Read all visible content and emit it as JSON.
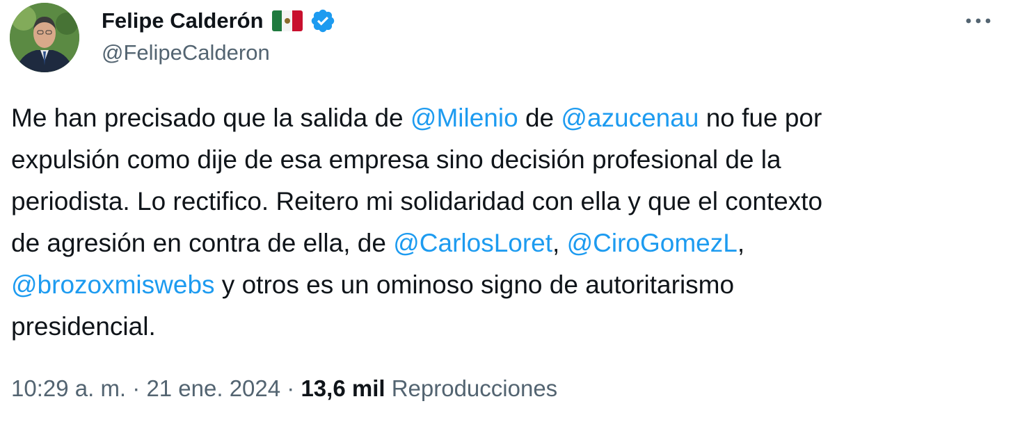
{
  "tweet": {
    "author": {
      "display_name": "Felipe Calderón",
      "flag_icon": "mexico-flag-icon",
      "verified_icon": "verified-badge-icon",
      "verified_color": "#1d9bf0",
      "handle": "@FelipeCalderon"
    },
    "more_icon": "more-horizontal-icon",
    "text_lines": [
      [
        {
          "t": "Me han precisado que la salida de "
        },
        {
          "t": "@Milenio",
          "mention": true
        },
        {
          "t": " de "
        },
        {
          "t": "@azucenau",
          "mention": true
        },
        {
          "t": " no fue por"
        }
      ],
      [
        {
          "t": "expulsión como dije de esa empresa sino decisión profesional de la"
        }
      ],
      [
        {
          "t": "periodista. Lo rectifico. Reitero mi solidaridad con ella y que el contexto"
        }
      ],
      [
        {
          "t": "de agresión en contra de ella, de "
        },
        {
          "t": "@CarlosLoret",
          "mention": true
        },
        {
          "t": ", "
        },
        {
          "t": "@CiroGomezL",
          "mention": true
        },
        {
          "t": ","
        }
      ],
      [
        {
          "t": "@brozoxmiswebs",
          "mention": true
        },
        {
          "t": " y otros es un ominoso signo de autoritarismo"
        }
      ],
      [
        {
          "t": "presidencial."
        }
      ]
    ],
    "meta": {
      "time": "10:29 a. m.",
      "separator": " · ",
      "date": "21 ene. 2024",
      "views_count": "13,6 mil",
      "views_label": "Reproducciones"
    },
    "colors": {
      "mention": "#1d9bf0",
      "text": "#0f1419",
      "secondary": "#536471"
    }
  }
}
